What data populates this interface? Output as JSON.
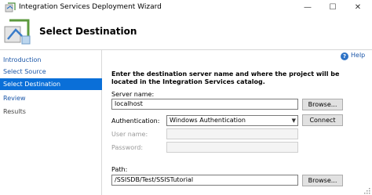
{
  "window": {
    "title": "Integration Services Deployment Wizard",
    "minimize_glyph": "—",
    "maximize_glyph": "☐",
    "close_glyph": "✕"
  },
  "header": {
    "title": "Select Destination"
  },
  "sidebar": {
    "items": [
      {
        "label": "Introduction",
        "state": "link"
      },
      {
        "label": "Select Source",
        "state": "link"
      },
      {
        "label": "Select Destination",
        "state": "active"
      },
      {
        "label": "Review",
        "state": "link"
      },
      {
        "label": "Results",
        "state": "disabled"
      }
    ]
  },
  "help": {
    "label": "Help",
    "icon": "help-icon",
    "icon_glyph": "?"
  },
  "form": {
    "instruction": "Enter the destination server name and where the project will be located in the Integration Services catalog.",
    "server_name": {
      "label": "Server name:",
      "value": "localhost",
      "browse_label": "Browse..."
    },
    "authentication": {
      "label": "Authentication:",
      "value": "Windows Authentication",
      "connect_label": "Connect"
    },
    "user_name": {
      "label": "User name:",
      "value": ""
    },
    "password": {
      "label": "Password:",
      "value": ""
    },
    "path": {
      "label": "Path:",
      "value": "/SSISDB/Test/SSISTutorial",
      "browse_label": "Browse..."
    }
  },
  "colors": {
    "accent": "#0a6fd8",
    "link": "#1a56a8"
  }
}
